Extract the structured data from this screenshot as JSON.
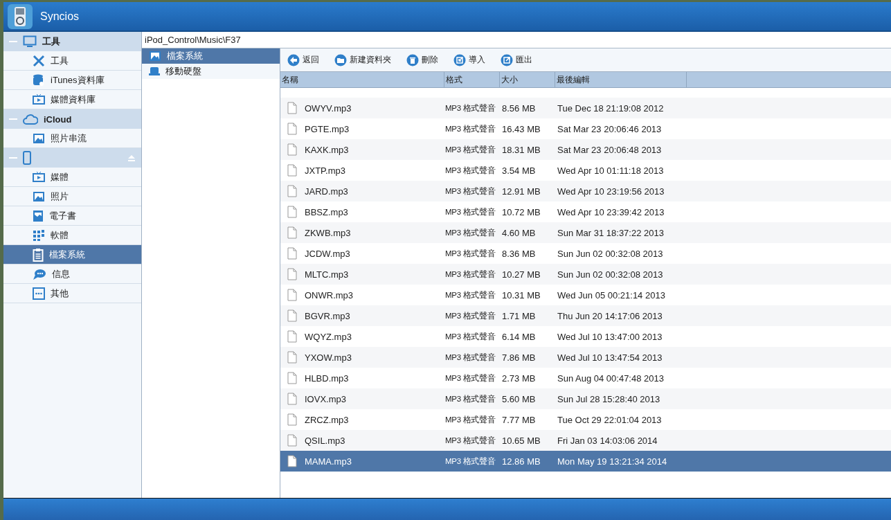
{
  "window": {
    "title": "Syncios"
  },
  "sidebar": {
    "groups": [
      {
        "label": "工具",
        "items": [
          {
            "label": "工具",
            "selected": false
          },
          {
            "label": "iTunes資料庫",
            "selected": false
          },
          {
            "label": "媒體資料庫",
            "selected": false
          }
        ]
      },
      {
        "label": "iCloud",
        "items": [
          {
            "label": "照片串流",
            "selected": false
          }
        ]
      },
      {
        "items": [
          {
            "label": "媒體",
            "selected": false
          },
          {
            "label": "照片",
            "selected": false
          },
          {
            "label": "電子書",
            "selected": false
          },
          {
            "label": "軟體",
            "selected": false
          },
          {
            "label": "檔案系統",
            "selected": true
          },
          {
            "label": "信息",
            "selected": false
          },
          {
            "label": "其他",
            "selected": false
          }
        ]
      }
    ]
  },
  "path": "iPod_Control\\Music\\F37",
  "tree": [
    {
      "label": "檔案系統",
      "selected": true
    },
    {
      "label": "移動硬盤",
      "selected": false
    }
  ],
  "toolbar": [
    "返回",
    "新建資料夾",
    "刪除",
    "導入",
    "匯出"
  ],
  "table": {
    "columns": [
      "名稱",
      "格式",
      "大小",
      "最後編輯"
    ],
    "rows": [
      {
        "name": "OWYV.mp3",
        "format": "MP3 格式聲音",
        "size": "8.56 MB",
        "modified": "Tue Dec 18 21:19:08 2012",
        "selected": false
      },
      {
        "name": "PGTE.mp3",
        "format": "MP3 格式聲音",
        "size": "16.43 MB",
        "modified": "Sat Mar 23 20:06:46 2013",
        "selected": false
      },
      {
        "name": "KAXK.mp3",
        "format": "MP3 格式聲音",
        "size": "18.31 MB",
        "modified": "Sat Mar 23 20:06:48 2013",
        "selected": false
      },
      {
        "name": "JXTP.mp3",
        "format": "MP3 格式聲音",
        "size": "3.54 MB",
        "modified": "Wed Apr 10 01:11:18 2013",
        "selected": false
      },
      {
        "name": "JARD.mp3",
        "format": "MP3 格式聲音",
        "size": "12.91 MB",
        "modified": "Wed Apr 10 23:19:56 2013",
        "selected": false
      },
      {
        "name": "BBSZ.mp3",
        "format": "MP3 格式聲音",
        "size": "10.72 MB",
        "modified": "Wed Apr 10 23:39:42 2013",
        "selected": false
      },
      {
        "name": "ZKWB.mp3",
        "format": "MP3 格式聲音",
        "size": "4.60 MB",
        "modified": "Sun Mar 31 18:37:22 2013",
        "selected": false
      },
      {
        "name": "JCDW.mp3",
        "format": "MP3 格式聲音",
        "size": "8.36 MB",
        "modified": "Sun Jun 02 00:32:08 2013",
        "selected": false
      },
      {
        "name": "MLTC.mp3",
        "format": "MP3 格式聲音",
        "size": "10.27 MB",
        "modified": "Sun Jun 02 00:32:08 2013",
        "selected": false
      },
      {
        "name": "ONWR.mp3",
        "format": "MP3 格式聲音",
        "size": "10.31 MB",
        "modified": "Wed Jun 05 00:21:14 2013",
        "selected": false
      },
      {
        "name": "BGVR.mp3",
        "format": "MP3 格式聲音",
        "size": "1.71 MB",
        "modified": "Thu Jun 20 14:17:06 2013",
        "selected": false
      },
      {
        "name": "WQYZ.mp3",
        "format": "MP3 格式聲音",
        "size": "6.14 MB",
        "modified": "Wed Jul 10 13:47:00 2013",
        "selected": false
      },
      {
        "name": "YXOW.mp3",
        "format": "MP3 格式聲音",
        "size": "7.86 MB",
        "modified": "Wed Jul 10 13:47:54 2013",
        "selected": false
      },
      {
        "name": "HLBD.mp3",
        "format": "MP3 格式聲音",
        "size": "2.73 MB",
        "modified": "Sun Aug 04 00:47:48 2013",
        "selected": false
      },
      {
        "name": "IOVX.mp3",
        "format": "MP3 格式聲音",
        "size": "5.60 MB",
        "modified": "Sun Jul 28 15:28:40 2013",
        "selected": false
      },
      {
        "name": "ZRCZ.mp3",
        "format": "MP3 格式聲音",
        "size": "7.77 MB",
        "modified": "Tue Oct 29 22:01:04 2013",
        "selected": false
      },
      {
        "name": "QSIL.mp3",
        "format": "MP3 格式聲音",
        "size": "10.65 MB",
        "modified": "Fri Jan 03 14:03:06 2014",
        "selected": false
      },
      {
        "name": "MAMA.mp3",
        "format": "MP3 格式聲音",
        "size": "12.86 MB",
        "modified": "Mon May 19 13:21:34 2014",
        "selected": true
      }
    ]
  }
}
